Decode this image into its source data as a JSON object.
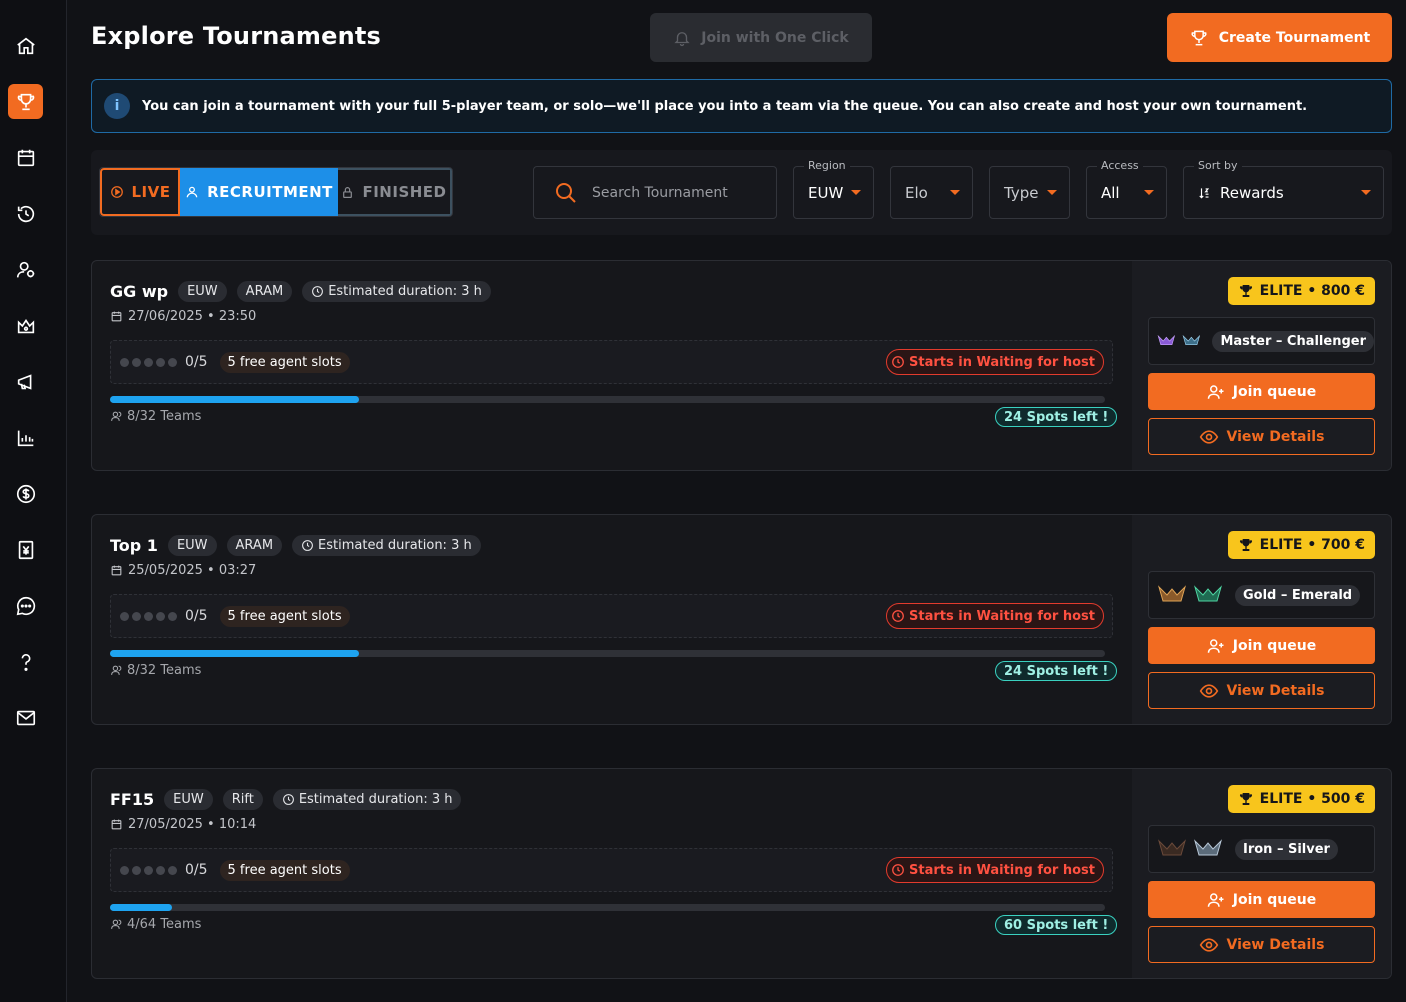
{
  "page": {
    "title": "Explore Tournaments",
    "join_one_click": "Join with One Click",
    "create_tournament": "Create Tournament"
  },
  "banner": {
    "text": "You can join a tournament with your full 5-player team, or solo—we'll place you into a team via the queue. You can also create and host your own tournament."
  },
  "filters": {
    "tabs": {
      "live": "LIVE",
      "recruitment": "RECRUITMENT",
      "finished": "FINISHED",
      "active": "recruitment"
    },
    "search_placeholder": "Search Tournament",
    "region": {
      "label": "Region",
      "value": "EUW"
    },
    "elo": {
      "value": "Elo"
    },
    "type": {
      "value": "Type"
    },
    "access": {
      "label": "Access",
      "value": "All"
    },
    "sort": {
      "label": "Sort by",
      "value": "Rewards"
    }
  },
  "tournaments": [
    {
      "name": "GG wp",
      "region": "EUW",
      "mode": "ARAM",
      "duration": "Estimated duration: 3 h",
      "date": "27/06/2025 • 23:50",
      "players": "0/5",
      "free_slots": "5 free agent slots",
      "status": "Starts in Waiting for host",
      "teams": "8/32 Teams",
      "fill": 0.25,
      "spots": "24 Spots left !",
      "prize": "ELITE • 800 €",
      "rank": "Master – Challenger",
      "join": "Join queue",
      "details": "View Details"
    },
    {
      "name": "Top 1",
      "region": "EUW",
      "mode": "ARAM",
      "duration": "Estimated duration: 3 h",
      "date": "25/05/2025 • 03:27",
      "players": "0/5",
      "free_slots": "5 free agent slots",
      "status": "Starts in Waiting for host",
      "teams": "8/32 Teams",
      "fill": 0.25,
      "spots": "24 Spots left !",
      "prize": "ELITE • 700 €",
      "rank": "Gold – Emerald",
      "join": "Join queue",
      "details": "View Details"
    },
    {
      "name": "FF15",
      "region": "EUW",
      "mode": "Rift",
      "duration": "Estimated duration: 3 h",
      "date": "27/05/2025 • 10:14",
      "players": "0/5",
      "free_slots": "5 free agent slots",
      "status": "Starts in Waiting for host",
      "teams": "4/64 Teams",
      "fill": 0.0625,
      "spots": "60 Spots left !",
      "prize": "ELITE • 500 €",
      "rank": "Iron – Silver",
      "join": "Join queue",
      "details": "View Details"
    }
  ],
  "icons": {
    "sidebar": [
      "home-icon",
      "trophy-icon",
      "calendar-icon",
      "history-icon",
      "users-icon",
      "crown-icon",
      "megaphone-icon",
      "chart-icon",
      "dollar-icon",
      "yen-icon",
      "chat-icon",
      "help-icon",
      "mail-icon"
    ]
  },
  "colors": {
    "accent": "#f26b21",
    "recruitment": "#1d8fe8",
    "elite": "#f8c51c",
    "status": "#ff5141",
    "spots": "#3ad1c0"
  }
}
